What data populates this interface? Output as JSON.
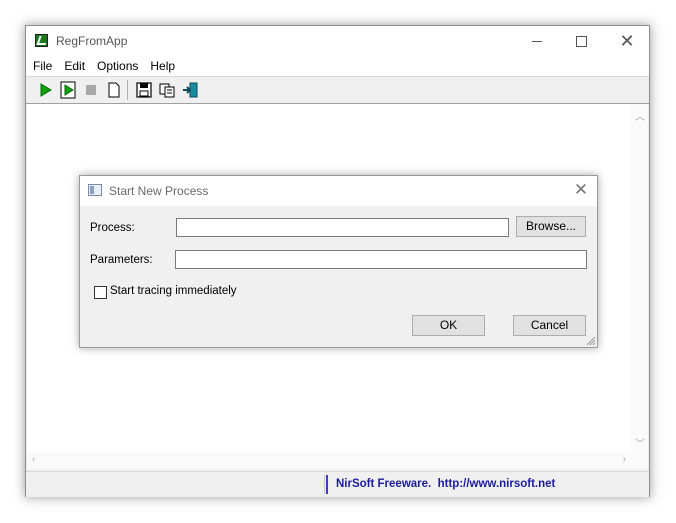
{
  "window": {
    "title": "RegFromApp"
  },
  "menu": {
    "items": [
      "File",
      "Edit",
      "Options",
      "Help"
    ]
  },
  "toolbar": {
    "buttons": [
      {
        "icon": "play-icon",
        "color": "#10a010"
      },
      {
        "icon": "play-framed-icon",
        "color": "#10a010"
      },
      {
        "icon": "stop-icon",
        "color": "#9a9a9a"
      },
      {
        "icon": "new-document-icon"
      },
      {
        "icon": "save-icon"
      },
      {
        "icon": "copy-icon"
      },
      {
        "icon": "exit-icon",
        "color": "#1a8aa0"
      }
    ]
  },
  "status": {
    "link_text": "NirSoft Freeware.  http://www.nirsoft.net",
    "link_color": "#1c1ca0"
  },
  "dialog": {
    "title": "Start New Process",
    "process_label": "Process:",
    "process_value": "",
    "browse_label": "Browse...",
    "parameters_label": "Parameters:",
    "parameters_value": "",
    "tracing_label": "Start tracing immediately",
    "tracing_checked": false,
    "ok_label": "OK",
    "cancel_label": "Cancel"
  }
}
